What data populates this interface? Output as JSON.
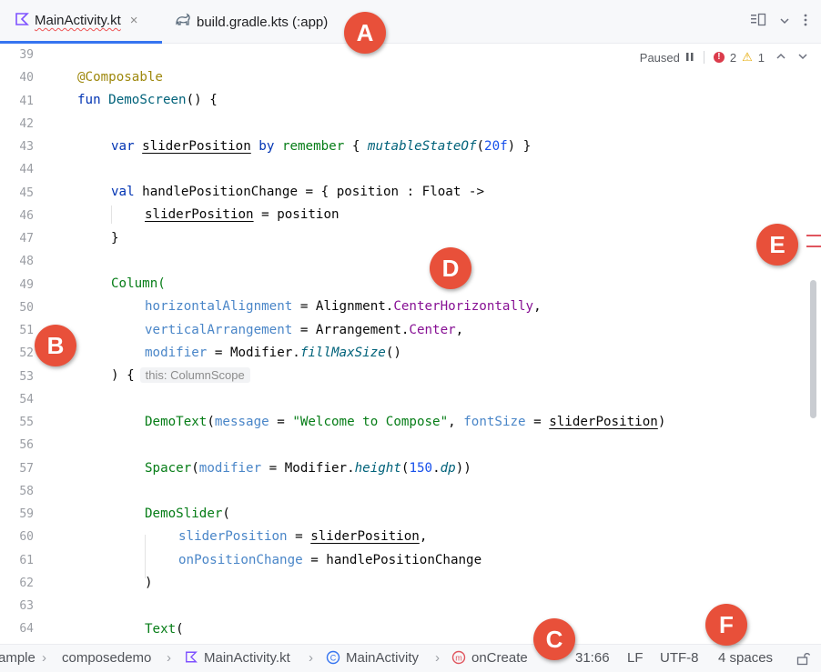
{
  "tabs": [
    {
      "label": "MainActivity.kt",
      "close": "×"
    },
    {
      "label": "build.gradle.kts (:app)"
    }
  ],
  "inspection": {
    "status": "Paused",
    "errors": "2",
    "warnings": "1"
  },
  "gutter": [
    "39",
    "40",
    "41",
    "42",
    "43",
    "44",
    "45",
    "46",
    "47",
    "48",
    "49",
    "50",
    "51",
    "52",
    "53",
    "54",
    "55",
    "56",
    "57",
    "58",
    "59",
    "60",
    "61",
    "62",
    "63",
    "64"
  ],
  "code": {
    "l40": "@Composable",
    "l41a": "fun ",
    "l41b": "DemoScreen",
    "l41c": "() {",
    "l43a": "var ",
    "l43b": "sliderPosition",
    "l43c": " by ",
    "l43d": "remember",
    "l43e": " { ",
    "l43f": "mutableStateOf",
    "l43g": "(",
    "l43h": "20f",
    "l43i": ") }",
    "l45a": "val ",
    "l45b": "handlePositionChange = { position : Float ->",
    "l46a": "sliderPosition",
    "l46b": " = position",
    "l47": "}",
    "l49": "Column(",
    "l50a": "horizontalAlignment",
    "l50b": " = Alignment.",
    "l50c": "CenterHorizontally",
    "l50d": ",",
    "l51a": "verticalArrangement",
    "l51b": " = Arrangement.",
    "l51c": "Center",
    "l51d": ",",
    "l52a": "modifier",
    "l52b": " = Modifier.",
    "l52c": "fillMaxSize",
    "l52d": "()",
    "l53a": ") {",
    "l53hint": "this: ColumnScope",
    "l55a": "DemoText",
    "l55b": "(",
    "l55c": "message",
    "l55d": " = ",
    "l55e": "\"Welcome to Compose\"",
    "l55f": ", ",
    "l55g": "fontSize",
    "l55h": " = ",
    "l55i": "sliderPosition",
    "l55j": ")",
    "l57a": "Spacer",
    "l57b": "(",
    "l57c": "modifier",
    "l57d": " = Modifier.",
    "l57e": "height",
    "l57f": "(",
    "l57g": "150",
    "l57h": ".",
    "l57i": "dp",
    "l57j": "))",
    "l59a": "DemoSlider",
    "l59b": "(",
    "l60a": "sliderPosition",
    "l60b": " = ",
    "l60c": "sliderPosition",
    "l60d": ",",
    "l61a": "onPositionChange",
    "l61b": " = handlePositionChange",
    "l62": ")",
    "l64a": "Text",
    "l64b": "("
  },
  "statusbar": {
    "crumb1": "ample",
    "crumb2": "composedemo",
    "crumb3": "MainActivity.kt",
    "crumb4": "MainActivity",
    "crumb5": "onCreate",
    "position": "31:66",
    "line_sep": "LF",
    "encoding": "UTF-8",
    "indent": "4 spaces",
    "sep": "›"
  },
  "callouts": {
    "a": "A",
    "b": "B",
    "c": "C",
    "d": "D",
    "e": "E",
    "f": "F"
  },
  "colors": {
    "accent": "#3574f0",
    "callout": "#e8503a",
    "error": "#db3b4b",
    "warning": "#e5a800"
  }
}
